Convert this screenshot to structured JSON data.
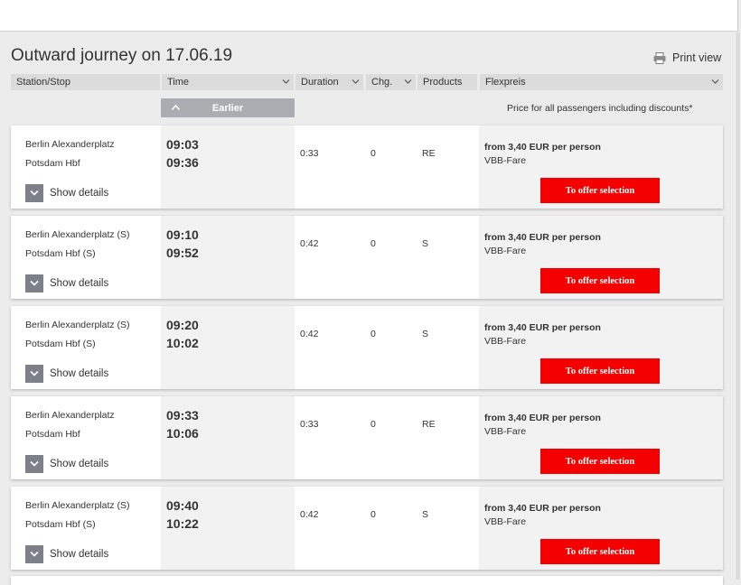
{
  "header": {
    "title": "Outward journey on 17.06.19",
    "print_label": "Print view"
  },
  "columns": [
    {
      "label": "Station/Stop"
    },
    {
      "label": "Time"
    },
    {
      "label": "Duration"
    },
    {
      "label": "Chg."
    },
    {
      "label": "Products"
    },
    {
      "label": "Flexpreis"
    }
  ],
  "earlier_label": "Earlier",
  "price_note": "Price for all passengers including discounts*",
  "show_details_label": "Show details",
  "offer_label": "To offer selection",
  "connections": [
    {
      "from": "Berlin Alexanderplatz",
      "to": "Potsdam Hbf",
      "dep": "09:03",
      "arr": "09:36",
      "duration": "0:33",
      "changes": "0",
      "products": "RE",
      "price": "from 3,40 EUR per person",
      "fare": "VBB-Fare"
    },
    {
      "from": "Berlin Alexanderplatz (S)",
      "to": "Potsdam Hbf (S)",
      "dep": "09:10",
      "arr": "09:52",
      "duration": "0:42",
      "changes": "0",
      "products": "S",
      "price": "from 3,40 EUR per person",
      "fare": "VBB-Fare"
    },
    {
      "from": "Berlin Alexanderplatz (S)",
      "to": "Potsdam Hbf (S)",
      "dep": "09:20",
      "arr": "10:02",
      "duration": "0:42",
      "changes": "0",
      "products": "S",
      "price": "from 3,40 EUR per person",
      "fare": "VBB-Fare"
    },
    {
      "from": "Berlin Alexanderplatz",
      "to": "Potsdam Hbf",
      "dep": "09:33",
      "arr": "10:06",
      "duration": "0:33",
      "changes": "0",
      "products": "RE",
      "price": "from 3,40 EUR per person",
      "fare": "VBB-Fare"
    },
    {
      "from": "Berlin Alexanderplatz (S)",
      "to": "Potsdam Hbf (S)",
      "dep": "09:40",
      "arr": "10:22",
      "duration": "0:42",
      "changes": "0",
      "products": "S",
      "price": "from 3,40 EUR per person",
      "fare": "VBB-Fare"
    }
  ],
  "colors": {
    "offer_button": "#f50000",
    "details_box": "#7c8089",
    "earlier_button": "#aaadb2"
  },
  "icons": {
    "print": "printer-icon",
    "earlier": "chevron-up-icon",
    "details": "chevron-down-icon",
    "column_sort": "chevron-down-icon"
  }
}
